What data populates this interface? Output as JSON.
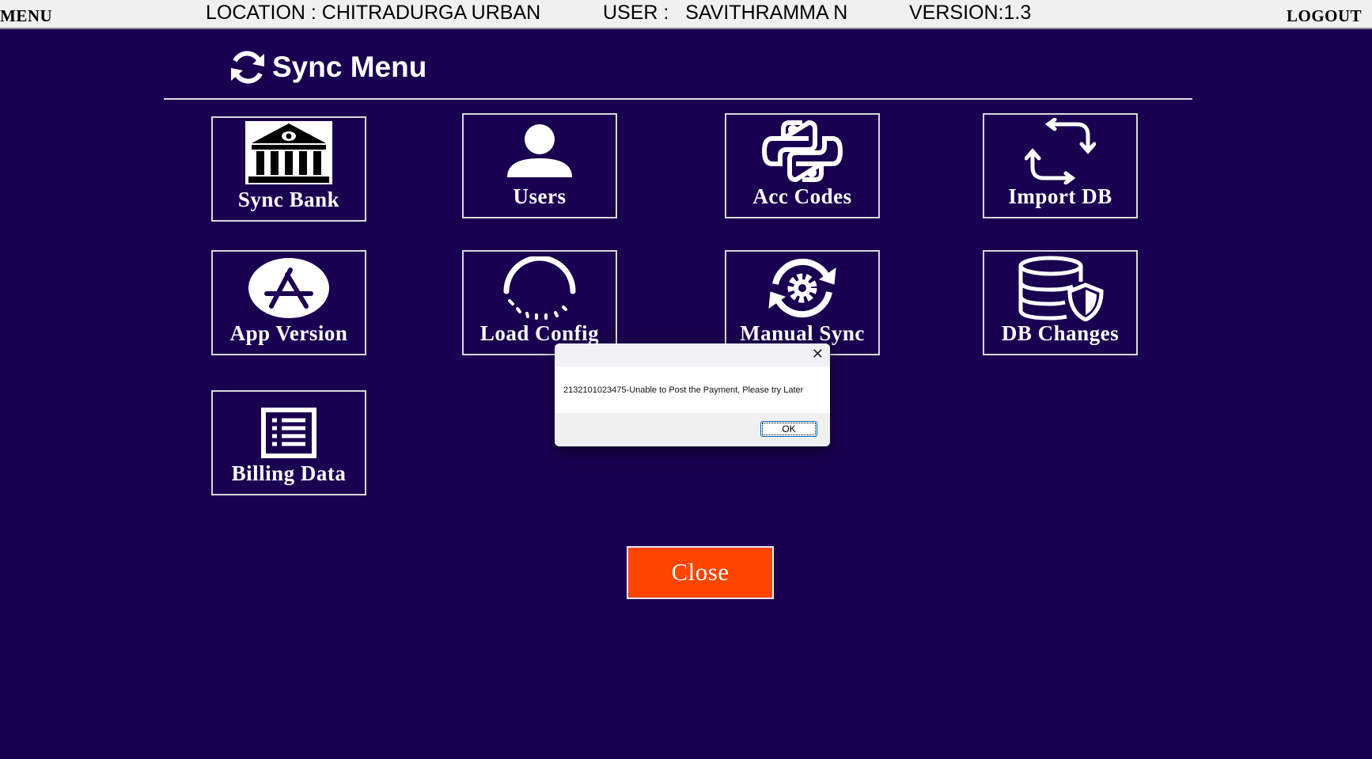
{
  "topbar": {
    "menu": "MENU",
    "location": "LOCATION : CHITRADURGA URBAN",
    "user": "USER :   SAVITHRAMMA N",
    "version": "VERSION:1.3",
    "logout": "LOGOUT"
  },
  "header": {
    "title": "Sync Menu",
    "icon": "sync-icon"
  },
  "tiles": [
    {
      "label": "Sync Bank",
      "icon": "bank-icon"
    },
    {
      "label": "Users",
      "icon": "user-icon"
    },
    {
      "label": "Acc Codes",
      "icon": "python-icon"
    },
    {
      "label": "Import DB",
      "icon": "import-icon"
    },
    {
      "label": "App Version",
      "icon": "app-store-icon"
    },
    {
      "label": "Load Config",
      "icon": "loading-icon"
    },
    {
      "label": "Manual Sync",
      "icon": "gear-sync-icon"
    },
    {
      "label": "DB Changes",
      "icon": "database-shield-icon"
    },
    {
      "label": "Billing Data",
      "icon": "list-icon"
    }
  ],
  "dialog": {
    "message": "2132101023475-Unable to Post the Payment, Please try Later",
    "ok": "OK",
    "close": "✕"
  },
  "close_button": "Close",
  "colors": {
    "background": "#1a0050",
    "close": "#ff4500"
  }
}
